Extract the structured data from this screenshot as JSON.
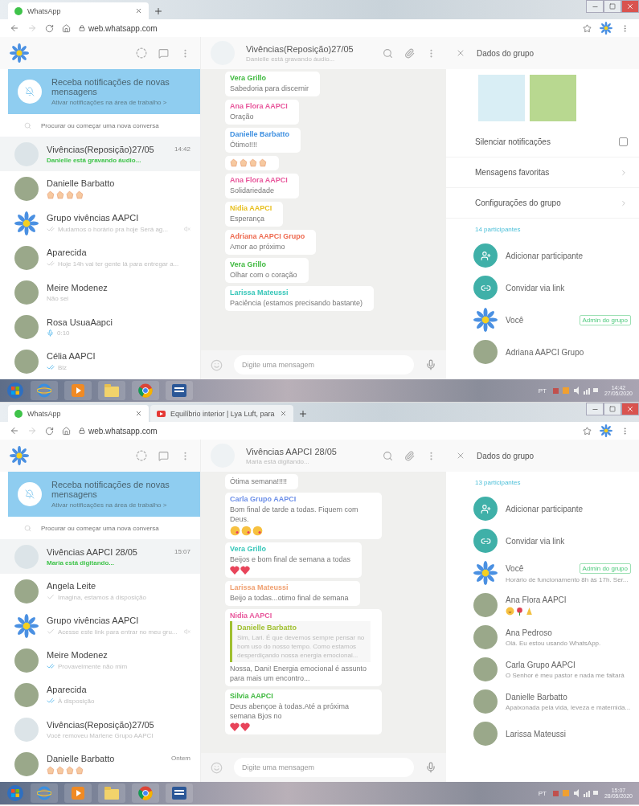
{
  "screens": [
    {
      "browser": {
        "tabs": [
          {
            "title": "WhatsApp",
            "kind": "whatsapp",
            "selected": true
          }
        ],
        "url": "web.whatsapp.com"
      },
      "sidebar": {
        "notification": {
          "title": "Receba notificações de novas mensagens",
          "subtitle": "Ativar notificações na área de trabalho >"
        },
        "search_placeholder": "Procurar ou começar uma nova conversa",
        "chats": [
          {
            "name": "Vivências(Reposição)27/05",
            "preview": "Danielle está gravando áudio...",
            "time": "14:42",
            "status": {
              "kind": "typing"
            },
            "avatar": {
              "kind": "group"
            },
            "selected": true,
            "muted": false
          },
          {
            "name": "Danielle Barbatto",
            "status": {
              "kind": "emoji"
            },
            "emojis": [
              {
                "kind": "clap"
              },
              {
                "kind": "clap"
              },
              {
                "kind": "clap"
              },
              {
                "kind": "clap"
              }
            ],
            "avatar": {
              "kind": "photo"
            },
            "selected": false,
            "muted": false
          },
          {
            "name": "Grupo vivências AAPCI",
            "preview": "Mudamos o horário pra hoje Será ag...",
            "status": {
              "kind": "delivered"
            },
            "avatar": {
              "kind": "flower"
            },
            "selected": false,
            "muted": true
          },
          {
            "name": "Aparecida",
            "preview": "Hoje 14h vai ter gente lá para entregar a...",
            "status": {
              "kind": "delivered"
            },
            "avatar": {
              "kind": "photo"
            },
            "selected": false,
            "muted": false
          },
          {
            "name": "Meire Modenez",
            "preview": "Não sei",
            "status": {
              "kind": "plain"
            },
            "avatar": {
              "kind": "photo"
            },
            "selected": false,
            "muted": false
          },
          {
            "name": "Rosa UsuaAapci",
            "preview": "0:10",
            "status": {
              "kind": "audio"
            },
            "avatar": {
              "kind": "photo"
            },
            "selected": false,
            "muted": false
          },
          {
            "name": "Célia AAPCI",
            "preview": "Blz",
            "status": {
              "kind": "read"
            },
            "avatar": {
              "kind": "photo"
            },
            "selected": false,
            "muted": false
          }
        ]
      },
      "conversation": {
        "title": "Vivências(Reposição)27/05",
        "subtitle": "Danielle está gravando áudio...",
        "input_placeholder": "Digite uma mensagem",
        "messages": [
          {
            "sender": "Vera Grillo",
            "color": "#3db83d",
            "text": "Sabedoria para discernir"
          },
          {
            "sender": "Ana Flora AAPCI",
            "color": "#e8569b",
            "text": "Oração"
          },
          {
            "sender": "Danielle Barbatto",
            "color": "#3d8fe0",
            "text": "Ótimo!!!!"
          },
          {
            "emojis": [
              {
                "kind": "clap"
              },
              {
                "kind": "clap"
              },
              {
                "kind": "clap"
              },
              {
                "kind": "clap"
              }
            ]
          },
          {
            "sender": "Ana Flora AAPCI",
            "color": "#e8569b",
            "text": "Solidariedade"
          },
          {
            "sender": "Nidia AAPCI",
            "color": "#e8c020",
            "text": "Esperança"
          },
          {
            "sender": "Adriana AAPCI Grupo",
            "color": "#ee6a50",
            "text": "Amor ao próximo"
          },
          {
            "sender": "Vera Grillo",
            "color": "#3db83d",
            "text": "Olhar com o coração"
          },
          {
            "sender": "Larissa Mateussi",
            "color": "#35c6b8",
            "text": "Paciência (estamos precisando bastante)"
          }
        ]
      },
      "group_panel": {
        "title": "Dados do grupo",
        "media": [
          {
            "kind": "jar"
          },
          {
            "kind": "book"
          }
        ],
        "options": [
          {
            "kind": "checkbox",
            "label": "Silenciar notificações",
            "checked": false
          },
          {
            "kind": "link",
            "label": "Mensagens favoritas"
          },
          {
            "kind": "link",
            "label": "Configurações do grupo"
          }
        ],
        "participants_count": "14 participantes",
        "actions": [
          {
            "kind": "add",
            "label": "Adicionar participante"
          },
          {
            "kind": "link",
            "label": "Convidar via link"
          }
        ],
        "participants": [
          {
            "name": "Você",
            "avatar": {
              "kind": "flower"
            },
            "badge": "Admin do grupo"
          },
          {
            "name": "Adriana AAPCI Grupo",
            "avatar": {
              "kind": "photo"
            }
          }
        ]
      },
      "taskbar": {
        "language": "PT",
        "time": "14:42",
        "date": "27/05/2020"
      }
    },
    {
      "browser": {
        "tabs": [
          {
            "title": "WhatsApp",
            "kind": "whatsapp",
            "selected": true
          },
          {
            "title": "Equilíbrio interior | Lya Luft, para",
            "kind": "video",
            "selected": false
          }
        ],
        "url": "web.whatsapp.com"
      },
      "sidebar": {
        "notification": {
          "title": "Receba notificações de novas mensagens",
          "subtitle": "Ativar notificações na área de trabalho >"
        },
        "search_placeholder": "Procurar ou começar uma nova conversa",
        "chats": [
          {
            "name": "Vivências AAPCI 28/05",
            "preview": "Maria está digitando...",
            "time": "15:07",
            "status": {
              "kind": "typing"
            },
            "avatar": {
              "kind": "group"
            },
            "selected": true,
            "muted": false
          },
          {
            "name": "Angela Leite",
            "preview": "Imagina, estamos à disposição",
            "status": {
              "kind": "sent"
            },
            "avatar": {
              "kind": "photo"
            },
            "selected": false,
            "muted": false
          },
          {
            "name": "Grupo vivências AAPCI",
            "preview": "Acesse este link para entrar no meu gru...",
            "status": {
              "kind": "sent"
            },
            "avatar": {
              "kind": "flower"
            },
            "selected": false,
            "muted": true
          },
          {
            "name": "Meire Modenez",
            "preview": "Provavelmente não mim",
            "status": {
              "kind": "read"
            },
            "avatar": {
              "kind": "photo"
            },
            "selected": false,
            "muted": false
          },
          {
            "name": "Aparecida",
            "preview": "À disposição",
            "status": {
              "kind": "read"
            },
            "avatar": {
              "kind": "photo"
            },
            "selected": false,
            "muted": false
          },
          {
            "name": "Vivências(Reposição)27/05",
            "preview": "Você removeu Marlene Grupo AAPCI",
            "status": {
              "kind": "plain"
            },
            "avatar": {
              "kind": "group"
            },
            "selected": false,
            "muted": false
          },
          {
            "name": "Danielle Barbatto",
            "time": "Ontem",
            "status": {
              "kind": "emoji"
            },
            "emojis": [
              {
                "kind": "clap"
              },
              {
                "kind": "clap"
              },
              {
                "kind": "clap"
              },
              {
                "kind": "clap"
              }
            ],
            "avatar": {
              "kind": "photo"
            },
            "selected": false,
            "muted": false
          }
        ]
      },
      "conversation": {
        "title": "Vivências AAPCI 28/05",
        "subtitle": "Maria está digitando...",
        "input_placeholder": "Digite uma mensagem",
        "messages": [
          {
            "text": "Ótima semana!!!!!"
          },
          {
            "sender": "Carla Grupo AAPCI",
            "color": "#6b8ee8",
            "text": "Bom final de tarde a todas. Fiquem com Deus.",
            "emojis": [
              {
                "kind": "kiss"
              },
              {
                "kind": "kiss"
              },
              {
                "kind": "kiss"
              }
            ]
          },
          {
            "sender": "Vera Grillo",
            "color": "#35c6b8",
            "text": "Beijos e bom final de semana a todas",
            "emojis": [
              {
                "kind": "heart"
              },
              {
                "kind": "heart"
              }
            ]
          },
          {
            "sender": "Larissa Mateussi",
            "color": "#f0a070",
            "text": "Beijo a todas...otimo final de semana"
          },
          {
            "sender": "Nidia AAPCI",
            "color": "#e8569b",
            "quote": {
              "sender": "Danielle Barbatto",
              "color": "#a0c030",
              "text": "Sim, Lari. É que  devemos sempre pensar no bom uso do nosso tempo. Como estamos desperdiçando nossa energia emocional..."
            },
            "text": "Nossa, Dani! Energia emocional é assunto para mais um encontro..."
          },
          {
            "sender": "Silvia AAPCI",
            "color": "#3db83d",
            "text": "Deus abençoe à  todas.Até  a próxima semana Bjos no",
            "emojis": [
              {
                "kind": "heart"
              },
              {
                "kind": "heart"
              }
            ]
          }
        ]
      },
      "group_panel": {
        "title": "Dados do grupo",
        "participants_count": "13 participantes",
        "actions": [
          {
            "kind": "add",
            "label": "Adicionar participante"
          },
          {
            "kind": "link",
            "label": "Convidar via link"
          }
        ],
        "participants": [
          {
            "name": "Você",
            "avatar": {
              "kind": "flower"
            },
            "badge": "Admin do grupo",
            "status": "Horário de funcionamento 8h às 17h. Ser..."
          },
          {
            "name": "Ana Flora AAPCI",
            "avatar": {
              "kind": "photo"
            },
            "emojis": [
              {
                "kind": "laugh"
              },
              {
                "kind": "rose"
              },
              {
                "kind": "pray"
              }
            ]
          },
          {
            "name": "Ana Pedroso",
            "avatar": {
              "kind": "photo"
            },
            "status": "Olá. Eu estou usando WhatsApp."
          },
          {
            "name": "Carla Grupo AAPCI",
            "avatar": {
              "kind": "photo"
            },
            "status": "O Senhor é meu pastor e nada me faltará"
          },
          {
            "name": "Danielle Barbatto",
            "avatar": {
              "kind": "photo"
            },
            "status": "Apaixonada pela vida, leveza e maternida..."
          },
          {
            "name": "Larissa Mateussi",
            "avatar": {
              "kind": "photo"
            }
          }
        ]
      },
      "taskbar": {
        "language": "PT",
        "time": "15:07",
        "date": "28/05/2020"
      }
    }
  ]
}
